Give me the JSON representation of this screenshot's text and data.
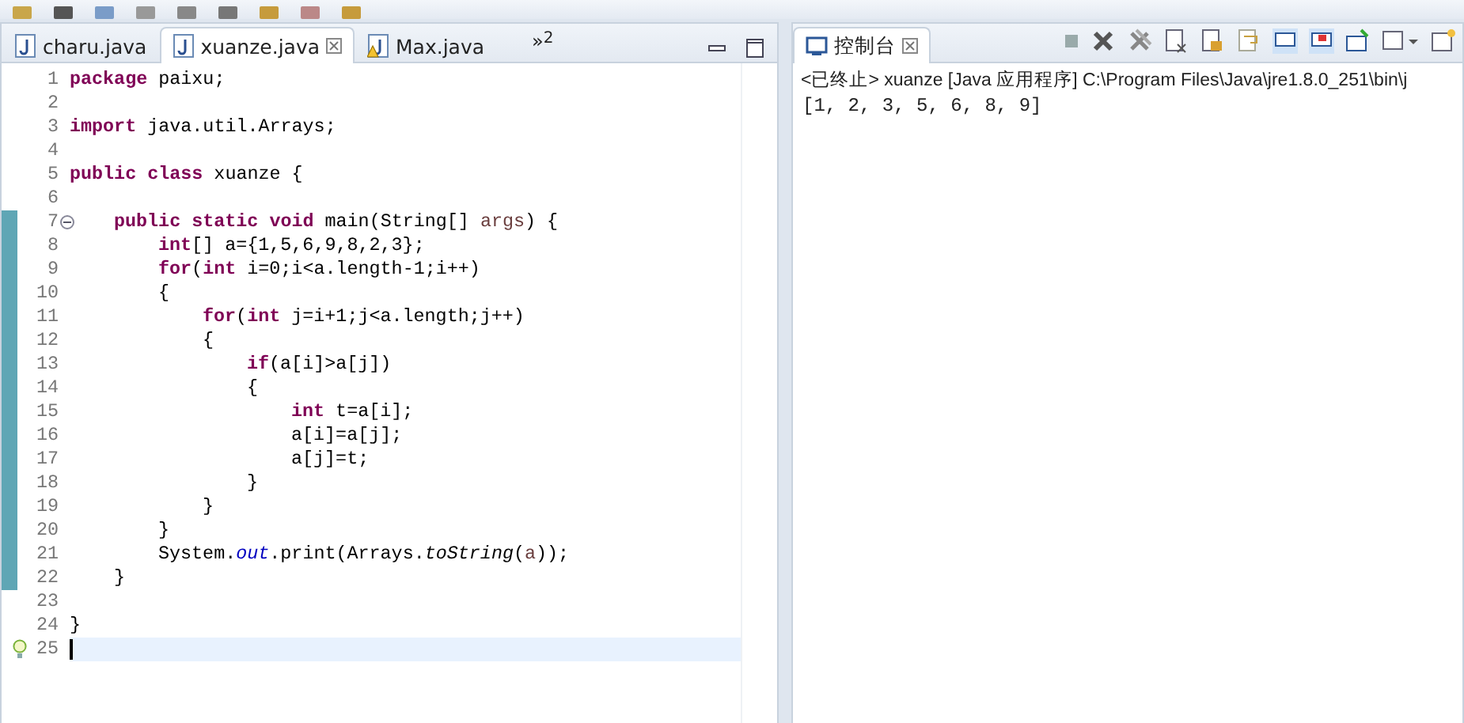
{
  "editor": {
    "tabs": [
      {
        "label": "charu.java",
        "selected": false,
        "closable": false,
        "warning": false
      },
      {
        "label": "xuanze.java",
        "selected": true,
        "closable": true,
        "warning": false
      },
      {
        "label": "Max.java",
        "selected": false,
        "closable": false,
        "warning": true
      }
    ],
    "overflow": {
      "glyph": "»",
      "count": "2"
    },
    "lines": [
      {
        "number": "1",
        "marked": false,
        "current": false,
        "collapse_toggle": false,
        "quick_fix": false,
        "segments": [
          {
            "kind": "kw",
            "text": "package"
          },
          {
            "kind": "plain",
            "text": " paixu;"
          }
        ]
      },
      {
        "number": "2",
        "marked": false,
        "current": false,
        "collapse_toggle": false,
        "quick_fix": false
      },
      {
        "number": "3",
        "marked": false,
        "current": false,
        "collapse_toggle": false,
        "quick_fix": false,
        "segments": [
          {
            "kind": "kw",
            "text": "import"
          },
          {
            "kind": "plain",
            "text": " java.util.Arrays;"
          }
        ]
      },
      {
        "number": "4",
        "marked": false,
        "current": false,
        "collapse_toggle": false,
        "quick_fix": false
      },
      {
        "number": "5",
        "marked": false,
        "current": false,
        "collapse_toggle": false,
        "quick_fix": false,
        "segments": [
          {
            "kind": "kw",
            "text": "public class"
          },
          {
            "kind": "plain",
            "text": " xuanze {"
          }
        ],
        "children": [
          {
            "number": "6",
            "marked": false,
            "current": false,
            "collapse_toggle": false,
            "quick_fix": false
          },
          {
            "number": "7",
            "marked": true,
            "current": false,
            "collapse_toggle": true,
            "quick_fix": false,
            "segments": [
              {
                "kind": "kw",
                "text": "public static void"
              },
              {
                "kind": "plain",
                "text": " main(String[] "
              },
              {
                "kind": "param",
                "text": "args"
              },
              {
                "kind": "plain",
                "text": ") {"
              }
            ],
            "children": [
              {
                "number": "8",
                "marked": true,
                "current": false,
                "collapse_toggle": false,
                "quick_fix": false,
                "segments": [
                  {
                    "kind": "kw",
                    "text": "int"
                  },
                  {
                    "kind": "plain",
                    "text": "[] a={1,5,6,9,8,2,3};"
                  }
                ]
              },
              {
                "number": "9",
                "marked": true,
                "current": false,
                "collapse_toggle": false,
                "quick_fix": false,
                "segments": [
                  {
                    "kind": "kw",
                    "text": "for"
                  },
                  {
                    "kind": "plain",
                    "text": "("
                  },
                  {
                    "kind": "kw",
                    "text": "int"
                  },
                  {
                    "kind": "plain",
                    "text": " i=0;i<a.length-1;i++)"
                  }
                ]
              },
              {
                "number": "10",
                "marked": true,
                "current": false,
                "collapse_toggle": false,
                "quick_fix": false,
                "segments": [
                  {
                    "kind": "plain",
                    "text": "{"
                  }
                ],
                "children": [
                  {
                    "number": "11",
                    "marked": true,
                    "current": false,
                    "collapse_toggle": false,
                    "quick_fix": false,
                    "segments": [
                      {
                        "kind": "kw",
                        "text": "for"
                      },
                      {
                        "kind": "plain",
                        "text": "("
                      },
                      {
                        "kind": "kw",
                        "text": "int"
                      },
                      {
                        "kind": "plain",
                        "text": " j=i+1;j<a.length;j++)"
                      }
                    ]
                  },
                  {
                    "number": "12",
                    "marked": true,
                    "current": false,
                    "collapse_toggle": false,
                    "quick_fix": false,
                    "segments": [
                      {
                        "kind": "plain",
                        "text": "{"
                      }
                    ],
                    "children": [
                      {
                        "number": "13",
                        "marked": true,
                        "current": false,
                        "collapse_toggle": false,
                        "quick_fix": false,
                        "segments": [
                          {
                            "kind": "kw",
                            "text": "if"
                          },
                          {
                            "kind": "plain",
                            "text": "(a[i]>a[j])"
                          }
                        ]
                      },
                      {
                        "number": "14",
                        "marked": true,
                        "current": false,
                        "collapse_toggle": false,
                        "quick_fix": false,
                        "segments": [
                          {
                            "kind": "plain",
                            "text": "{"
                          }
                        ],
                        "children": [
                          {
                            "number": "15",
                            "marked": true,
                            "current": false,
                            "collapse_toggle": false,
                            "quick_fix": false,
                            "segments": [
                              {
                                "kind": "kw",
                                "text": "int"
                              },
                              {
                                "kind": "plain",
                                "text": " t=a[i];"
                              }
                            ]
                          },
                          {
                            "number": "16",
                            "marked": true,
                            "current": false,
                            "collapse_toggle": false,
                            "quick_fix": false,
                            "segments": [
                              {
                                "kind": "plain",
                                "text": "a[i]=a[j];"
                              }
                            ]
                          },
                          {
                            "number": "17",
                            "marked": true,
                            "current": false,
                            "collapse_toggle": false,
                            "quick_fix": false,
                            "segments": [
                              {
                                "kind": "plain",
                                "text": "a[j]=t;"
                              }
                            ]
                          }
                        ]
                      },
                      {
                        "number": "18",
                        "marked": true,
                        "current": false,
                        "collapse_toggle": false,
                        "quick_fix": false,
                        "segments": [
                          {
                            "kind": "plain",
                            "text": "}"
                          }
                        ]
                      }
                    ]
                  },
                  {
                    "number": "19",
                    "marked": true,
                    "current": false,
                    "collapse_toggle": false,
                    "quick_fix": false,
                    "segments": [
                      {
                        "kind": "plain",
                        "text": "}"
                      }
                    ]
                  }
                ]
              },
              {
                "number": "20",
                "marked": true,
                "current": false,
                "collapse_toggle": false,
                "quick_fix": false,
                "segments": [
                  {
                    "kind": "plain",
                    "text": "}"
                  }
                ]
              },
              {
                "number": "21",
                "marked": true,
                "current": false,
                "collapse_toggle": false,
                "quick_fix": false,
                "segments": [
                  {
                    "kind": "plain",
                    "text": "System."
                  },
                  {
                    "kind": "field",
                    "text": "out"
                  },
                  {
                    "kind": "plain",
                    "text": ".print(Arrays."
                  },
                  {
                    "kind": "static",
                    "text": "toString"
                  },
                  {
                    "kind": "plain",
                    "text": "("
                  },
                  {
                    "kind": "param",
                    "text": "a"
                  },
                  {
                    "kind": "plain",
                    "text": "));"
                  }
                ]
              }
            ]
          },
          {
            "number": "22",
            "marked": true,
            "current": false,
            "collapse_toggle": false,
            "quick_fix": false,
            "segments": [
              {
                "kind": "plain",
                "text": "}"
              }
            ]
          }
        ]
      },
      {
        "number": "23",
        "marked": false,
        "current": false,
        "collapse_toggle": false,
        "quick_fix": false
      },
      {
        "number": "24",
        "marked": false,
        "current": false,
        "collapse_toggle": false,
        "quick_fix": false,
        "segments": [
          {
            "kind": "plain",
            "text": "}"
          }
        ]
      },
      {
        "number": "25",
        "marked": false,
        "current": true,
        "collapse_toggle": false,
        "quick_fix": true
      }
    ]
  },
  "console": {
    "tab": {
      "label": "控制台",
      "selected": true
    },
    "header": "<已终止> xuanze [Java 应用程序] C:\\Program Files\\Java\\jre1.8.0_251\\bin\\j",
    "output": [
      "[1, 2, 3, 5, 6, 8, 9]"
    ]
  }
}
